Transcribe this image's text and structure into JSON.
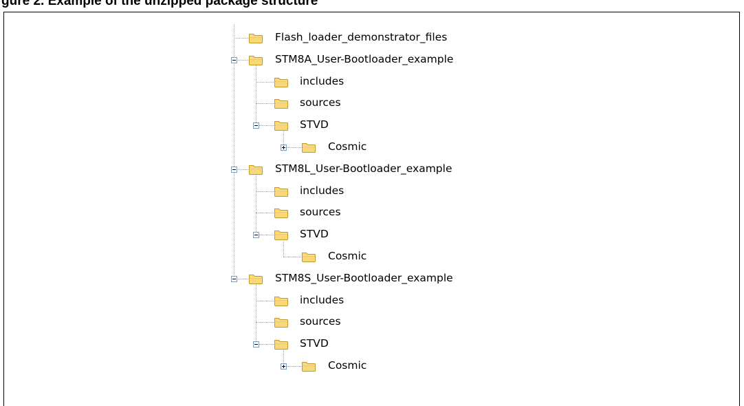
{
  "caption": "gure 2. Example of the unzipped package structure",
  "tree": {
    "items": [
      {
        "label": "Flash_loader_demonstrator_files",
        "level": 0,
        "toggle": "none"
      },
      {
        "label": "STM8A_User-Bootloader_example",
        "level": 0,
        "toggle": "expanded"
      },
      {
        "label": "includes",
        "level": 1,
        "toggle": "none"
      },
      {
        "label": "sources",
        "level": 1,
        "toggle": "none"
      },
      {
        "label": "STVD",
        "level": 1,
        "toggle": "expanded"
      },
      {
        "label": "Cosmic",
        "level": 2,
        "toggle": "collapsed"
      },
      {
        "label": "STM8L_User-Bootloader_example",
        "level": 0,
        "toggle": "expanded"
      },
      {
        "label": "includes",
        "level": 1,
        "toggle": "none"
      },
      {
        "label": "sources",
        "level": 1,
        "toggle": "none"
      },
      {
        "label": "STVD",
        "level": 1,
        "toggle": "expanded"
      },
      {
        "label": "Cosmic",
        "level": 2,
        "toggle": "none"
      },
      {
        "label": "STM8S_User-Bootloader_example",
        "level": 0,
        "toggle": "expanded"
      },
      {
        "label": "includes",
        "level": 1,
        "toggle": "none"
      },
      {
        "label": "sources",
        "level": 1,
        "toggle": "none"
      },
      {
        "label": "STVD",
        "level": 1,
        "toggle": "expanded"
      },
      {
        "label": "Cosmic",
        "level": 2,
        "toggle": "collapsed"
      }
    ]
  },
  "icons": {
    "folder": "folder-icon",
    "expanded": "minus-box-icon",
    "collapsed": "plus-box-icon"
  },
  "colors": {
    "folder_fill": "#f8d878",
    "folder_edge": "#c59a2b",
    "connector": "#a0a0a0",
    "toggle_border": "#7f9db9"
  }
}
